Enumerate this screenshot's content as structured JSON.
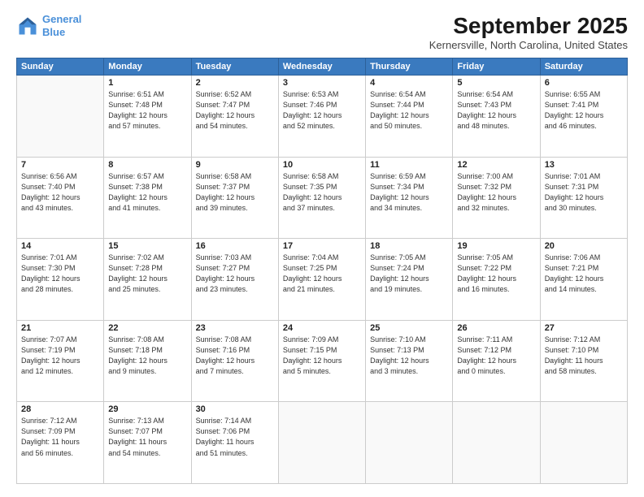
{
  "header": {
    "logo_line1": "General",
    "logo_line2": "Blue",
    "month": "September 2025",
    "location": "Kernersville, North Carolina, United States"
  },
  "weekdays": [
    "Sunday",
    "Monday",
    "Tuesday",
    "Wednesday",
    "Thursday",
    "Friday",
    "Saturday"
  ],
  "weeks": [
    [
      {
        "day": "",
        "info": ""
      },
      {
        "day": "1",
        "info": "Sunrise: 6:51 AM\nSunset: 7:48 PM\nDaylight: 12 hours\nand 57 minutes."
      },
      {
        "day": "2",
        "info": "Sunrise: 6:52 AM\nSunset: 7:47 PM\nDaylight: 12 hours\nand 54 minutes."
      },
      {
        "day": "3",
        "info": "Sunrise: 6:53 AM\nSunset: 7:46 PM\nDaylight: 12 hours\nand 52 minutes."
      },
      {
        "day": "4",
        "info": "Sunrise: 6:54 AM\nSunset: 7:44 PM\nDaylight: 12 hours\nand 50 minutes."
      },
      {
        "day": "5",
        "info": "Sunrise: 6:54 AM\nSunset: 7:43 PM\nDaylight: 12 hours\nand 48 minutes."
      },
      {
        "day": "6",
        "info": "Sunrise: 6:55 AM\nSunset: 7:41 PM\nDaylight: 12 hours\nand 46 minutes."
      }
    ],
    [
      {
        "day": "7",
        "info": "Sunrise: 6:56 AM\nSunset: 7:40 PM\nDaylight: 12 hours\nand 43 minutes."
      },
      {
        "day": "8",
        "info": "Sunrise: 6:57 AM\nSunset: 7:38 PM\nDaylight: 12 hours\nand 41 minutes."
      },
      {
        "day": "9",
        "info": "Sunrise: 6:58 AM\nSunset: 7:37 PM\nDaylight: 12 hours\nand 39 minutes."
      },
      {
        "day": "10",
        "info": "Sunrise: 6:58 AM\nSunset: 7:35 PM\nDaylight: 12 hours\nand 37 minutes."
      },
      {
        "day": "11",
        "info": "Sunrise: 6:59 AM\nSunset: 7:34 PM\nDaylight: 12 hours\nand 34 minutes."
      },
      {
        "day": "12",
        "info": "Sunrise: 7:00 AM\nSunset: 7:32 PM\nDaylight: 12 hours\nand 32 minutes."
      },
      {
        "day": "13",
        "info": "Sunrise: 7:01 AM\nSunset: 7:31 PM\nDaylight: 12 hours\nand 30 minutes."
      }
    ],
    [
      {
        "day": "14",
        "info": "Sunrise: 7:01 AM\nSunset: 7:30 PM\nDaylight: 12 hours\nand 28 minutes."
      },
      {
        "day": "15",
        "info": "Sunrise: 7:02 AM\nSunset: 7:28 PM\nDaylight: 12 hours\nand 25 minutes."
      },
      {
        "day": "16",
        "info": "Sunrise: 7:03 AM\nSunset: 7:27 PM\nDaylight: 12 hours\nand 23 minutes."
      },
      {
        "day": "17",
        "info": "Sunrise: 7:04 AM\nSunset: 7:25 PM\nDaylight: 12 hours\nand 21 minutes."
      },
      {
        "day": "18",
        "info": "Sunrise: 7:05 AM\nSunset: 7:24 PM\nDaylight: 12 hours\nand 19 minutes."
      },
      {
        "day": "19",
        "info": "Sunrise: 7:05 AM\nSunset: 7:22 PM\nDaylight: 12 hours\nand 16 minutes."
      },
      {
        "day": "20",
        "info": "Sunrise: 7:06 AM\nSunset: 7:21 PM\nDaylight: 12 hours\nand 14 minutes."
      }
    ],
    [
      {
        "day": "21",
        "info": "Sunrise: 7:07 AM\nSunset: 7:19 PM\nDaylight: 12 hours\nand 12 minutes."
      },
      {
        "day": "22",
        "info": "Sunrise: 7:08 AM\nSunset: 7:18 PM\nDaylight: 12 hours\nand 9 minutes."
      },
      {
        "day": "23",
        "info": "Sunrise: 7:08 AM\nSunset: 7:16 PM\nDaylight: 12 hours\nand 7 minutes."
      },
      {
        "day": "24",
        "info": "Sunrise: 7:09 AM\nSunset: 7:15 PM\nDaylight: 12 hours\nand 5 minutes."
      },
      {
        "day": "25",
        "info": "Sunrise: 7:10 AM\nSunset: 7:13 PM\nDaylight: 12 hours\nand 3 minutes."
      },
      {
        "day": "26",
        "info": "Sunrise: 7:11 AM\nSunset: 7:12 PM\nDaylight: 12 hours\nand 0 minutes."
      },
      {
        "day": "27",
        "info": "Sunrise: 7:12 AM\nSunset: 7:10 PM\nDaylight: 11 hours\nand 58 minutes."
      }
    ],
    [
      {
        "day": "28",
        "info": "Sunrise: 7:12 AM\nSunset: 7:09 PM\nDaylight: 11 hours\nand 56 minutes."
      },
      {
        "day": "29",
        "info": "Sunrise: 7:13 AM\nSunset: 7:07 PM\nDaylight: 11 hours\nand 54 minutes."
      },
      {
        "day": "30",
        "info": "Sunrise: 7:14 AM\nSunset: 7:06 PM\nDaylight: 11 hours\nand 51 minutes."
      },
      {
        "day": "",
        "info": ""
      },
      {
        "day": "",
        "info": ""
      },
      {
        "day": "",
        "info": ""
      },
      {
        "day": "",
        "info": ""
      }
    ]
  ]
}
